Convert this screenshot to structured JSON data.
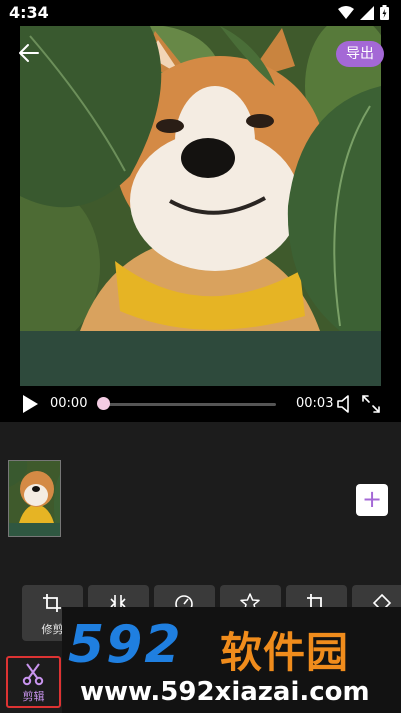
{
  "status_bar": {
    "time": "4:34",
    "icons": [
      "wifi-icon",
      "signal-icon",
      "battery-icon"
    ]
  },
  "preview": {
    "back_icon": "back-arrow-icon",
    "export_label": "导出",
    "accent_color": "#a468d6"
  },
  "player": {
    "current_time": "00:00",
    "total_time": "00:03",
    "progress": 0,
    "play_icon": "play-icon",
    "volume_icon": "volume-icon",
    "fullscreen_icon": "fullscreen-icon"
  },
  "timeline": {
    "add_label": "+"
  },
  "tools": [
    {
      "label": "修剪",
      "icon": "crop-icon"
    },
    {
      "label": "",
      "icon": "split-icon"
    },
    {
      "label": "",
      "icon": "speed-icon"
    },
    {
      "label": "",
      "icon": "star-icon"
    },
    {
      "label": "",
      "icon": "crop-alt-icon"
    },
    {
      "label": "",
      "icon": "shape-icon"
    }
  ],
  "bottom_tabs": {
    "cut_label": "剪辑",
    "cut_icon": "scissors-icon"
  },
  "watermark": {
    "logo_number": "592",
    "logo_name": "软件园",
    "url": "www.592xiazai.com"
  }
}
